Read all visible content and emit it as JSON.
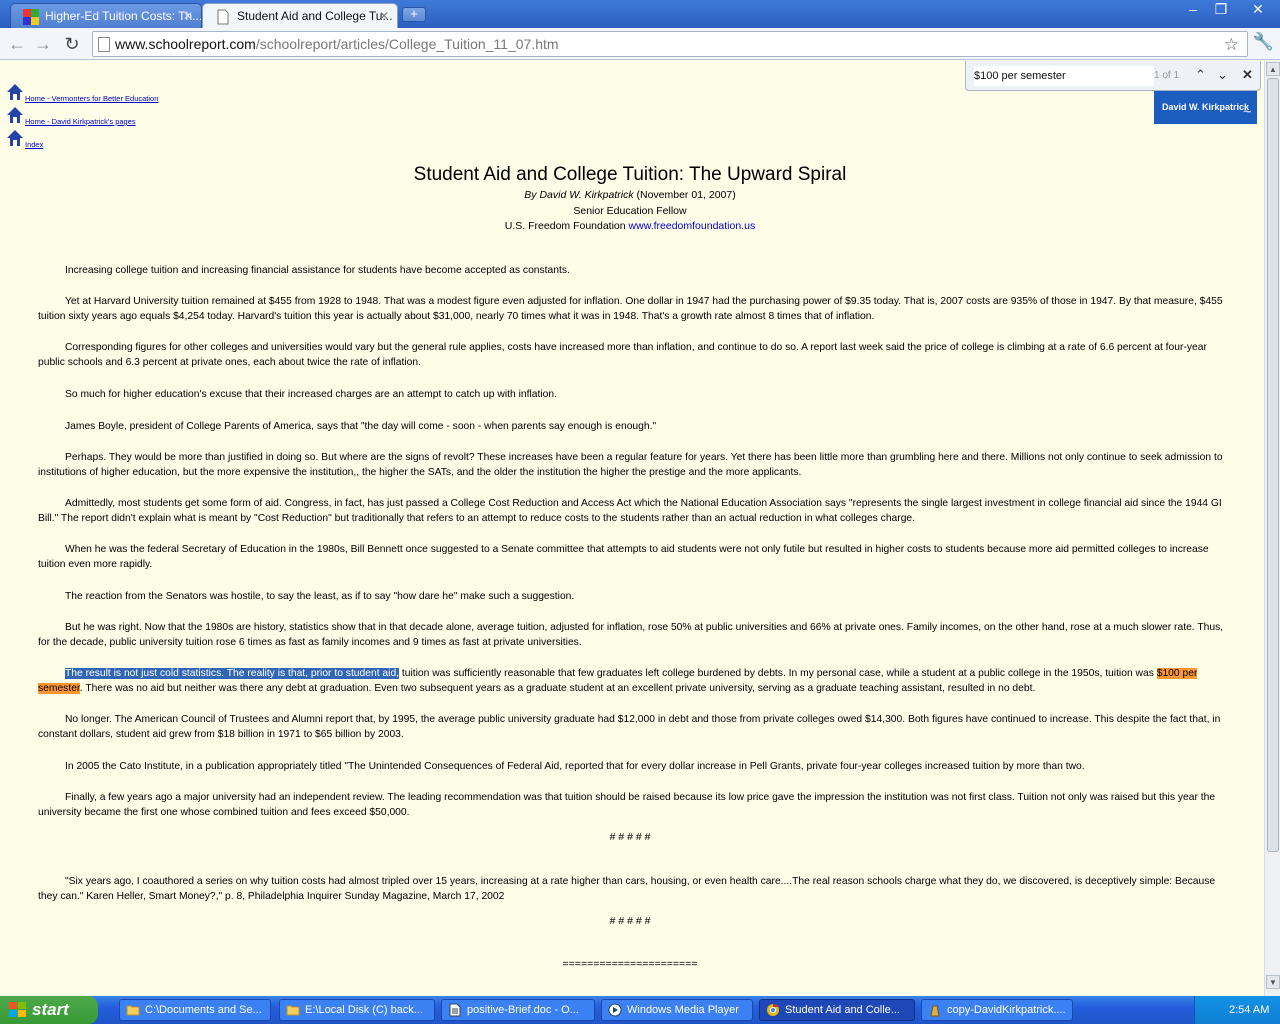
{
  "browser": {
    "tabs": [
      {
        "label": "Higher-Ed Tuition Costs: Th...",
        "active": false
      },
      {
        "label": "Student Aid and College Tu...",
        "active": true
      }
    ],
    "url_host": "www.schoolreport.com",
    "url_path": "/schoolreport/articles/College_Tuition_11_07.htm",
    "find": {
      "query": "$100 per semester",
      "count": "1 of 1"
    }
  },
  "nav_links": [
    "Home - Vermonters for Better Education",
    "Home - David Kirkpatrick's pages",
    "Index"
  ],
  "logo_text": "David W. Kirkpatrick",
  "article": {
    "title": "Student Aid and College Tuition: The Upward Spiral",
    "byline_author": "By David W. Kirkpatrick",
    "byline_date": "(November 01, 2007)",
    "position": "Senior Education Fellow",
    "org": "U.S. Freedom Foundation",
    "org_link": "www.freedomfoundation.us",
    "paragraphs": [
      "Increasing  college tuition and increasing financial assistance for students have become accepted as constants.",
      "Yet at Harvard University tuition remained at $455 from 1928 to 1948. That was a modest figure even adjusted for inflation.  One dollar in 1947 had the purchasing power of $9.35 today.  That is, 2007 costs are 935% of those in 1947.  By that measure, $455 tuition sixty years ago equals $4,254 today.  Harvard's tuition this year is actually about $31,000, nearly 70 times what it was in 1948.  That's a growth rate almost 8 times that of inflation.",
      "Corresponding figures for other colleges and universities would vary but the general rule applies, costs have increased more than inflation, and continue to do so.  A report last week said the price of college is climbing at a rate of 6.6 percent at four-year public schools and 6.3 percent at private ones, each about twice the rate of inflation.",
      "So much for higher education's excuse that their increased charges are an attempt to catch up with inflation.",
      "James Boyle, president of College Parents of America, says that \"the day will come - soon - when parents say enough is enough.\"",
      "Perhaps.  They would be more than justified in doing so. But where are the signs of revolt? These increases have been a regular feature for years. Yet there has been little more than grumbling here and there.  Millions not only continue to seek admission to institutions of higher education, but the more expensive the institution,, the higher the SATs, and the older the institution  the higher the prestige and the more applicants.",
      "Admittedly, most students get some form of aid.  Congress, in fact, has just passed a College Cost Reduction and Access Act which the National Education Association says \"represents the single largest investment in college financial aid since the 1944 GI Bill.\"  The report didn't explain what is meant by \"Cost Reduction\" but traditionally that refers to an attempt to reduce costs to the students rather than an actual reduction in what colleges charge.",
      "When he was the federal Secretary of Education in the 1980s, Bill Bennett once suggested to a Senate committee that attempts to aid students were not only futile but resulted in higher costs to students because more aid permitted colleges to increase tuition even more rapidly.",
      "The reaction from the Senators was hostile, to say the least, as if to say \"how dare he\" make such a suggestion.",
      "But he was right.  Now that the 1980s are history, statistics show that in that decade alone, average tuition, adjusted for inflation, rose 50% at public universities and 66% at private ones.  Family incomes, on the other hand, rose at a much slower rate.  Thus, for the decade, public university tuition rose 6 times as fast as family incomes and 9 times as fast at private universities."
    ],
    "highlight_paragraph": {
      "selected": "The result is not just cold statistics.  The reality is that, prior to student aid,",
      "before_find": " tuition was sufficiently reasonable that few graduates left college burdened by debts.  In my personal case, while a student at a public college in the 1950s, tuition was ",
      "find_match": "$100 per semester",
      "after_find": ".  There was no aid but neither was there any debt at graduation.  Even two subsequent years as a graduate student at an excellent private university, serving as a graduate teaching assistant, resulted in no debt."
    },
    "paragraphs_after": [
      "No longer. The American Council of Trustees and Alumni report that, by 1995, the average public university graduate had $12,000 in debt and those from private colleges owed $14,300.  Both figures have continued to increase.  This despite the fact that, in constant dollars, student aid grew from $18 billion in 1971 to $65 billion by 2003.",
      "In 2005 the Cato Institute, in a publication appropriately titled \"The Unintended Consequences of Federal Aid,  reported that for every dollar increase in Pell Grants, private four-year colleges increased tuition by more than two.",
      "Finally, a few years ago a major university had an independent review.  The leading recommendation was that tuition should be raised because its low price gave the impression the institution was not first class.  Tuition not only was raised but this year the university became the first one whose combined tuition and fees exceed $50,000."
    ],
    "separator": "# # # # #",
    "quote": "\"Six years ago, I coauthored a series on why tuition costs had almost tripled over 15 years, increasing at a rate higher than cars, housing, or even health care....The real reason schools charge what they do, we discovered, is deceptively simple: Because they can.\" Karen Heller, Smart Money?,\" p. 8, Philadelphia Inquirer Sunday Magazine, March 17, 2002",
    "separator2": "# # # # #",
    "rule": "======================"
  },
  "taskbar": {
    "start_label": "start",
    "tasks": [
      "C:\\Documents and Se...",
      "E:\\Local Disk (C) back...",
      "positive-Brief.doc - O...",
      "Windows Media Player",
      "Student Aid and Colle...",
      "copy-DavidKirkpatrick...."
    ],
    "clock": "2:54 AM"
  }
}
